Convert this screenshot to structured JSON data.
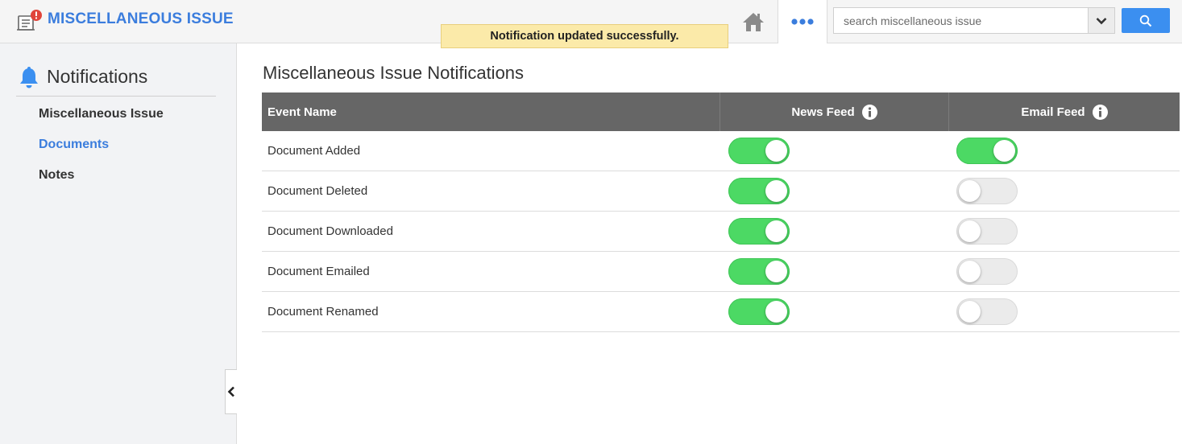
{
  "header": {
    "title": "MISCELLANEOUS ISSUE",
    "search_placeholder": "search miscellaneous issue"
  },
  "toast": "Notification updated successfully.",
  "sidebar": {
    "heading": "Notifications",
    "items": [
      {
        "label": "Miscellaneous Issue",
        "active": false
      },
      {
        "label": "Documents",
        "active": true
      },
      {
        "label": "Notes",
        "active": false
      }
    ]
  },
  "main": {
    "title": "Miscellaneous Issue Notifications",
    "columns": [
      "Event Name",
      "News Feed",
      "Email Feed"
    ],
    "rows": [
      {
        "event": "Document Added",
        "news_feed": true,
        "email_feed": true
      },
      {
        "event": "Document Deleted",
        "news_feed": true,
        "email_feed": false
      },
      {
        "event": "Document Downloaded",
        "news_feed": true,
        "email_feed": false
      },
      {
        "event": "Document Emailed",
        "news_feed": true,
        "email_feed": false
      },
      {
        "event": "Document Renamed",
        "news_feed": true,
        "email_feed": false
      }
    ]
  },
  "colors": {
    "accent": "#3b7ddd",
    "toggle_on": "#4cd964",
    "table_header": "#666666",
    "toast_bg": "#fbeaa9",
    "search_button": "#3b8ff0"
  },
  "icons": {
    "app": "document-alert-icon",
    "home": "home-icon",
    "more": "more-dots-icon",
    "dropdown": "chevron-down-icon",
    "search": "search-icon",
    "bell": "bell-icon",
    "info": "info-icon",
    "collapse": "chevron-left-icon"
  }
}
